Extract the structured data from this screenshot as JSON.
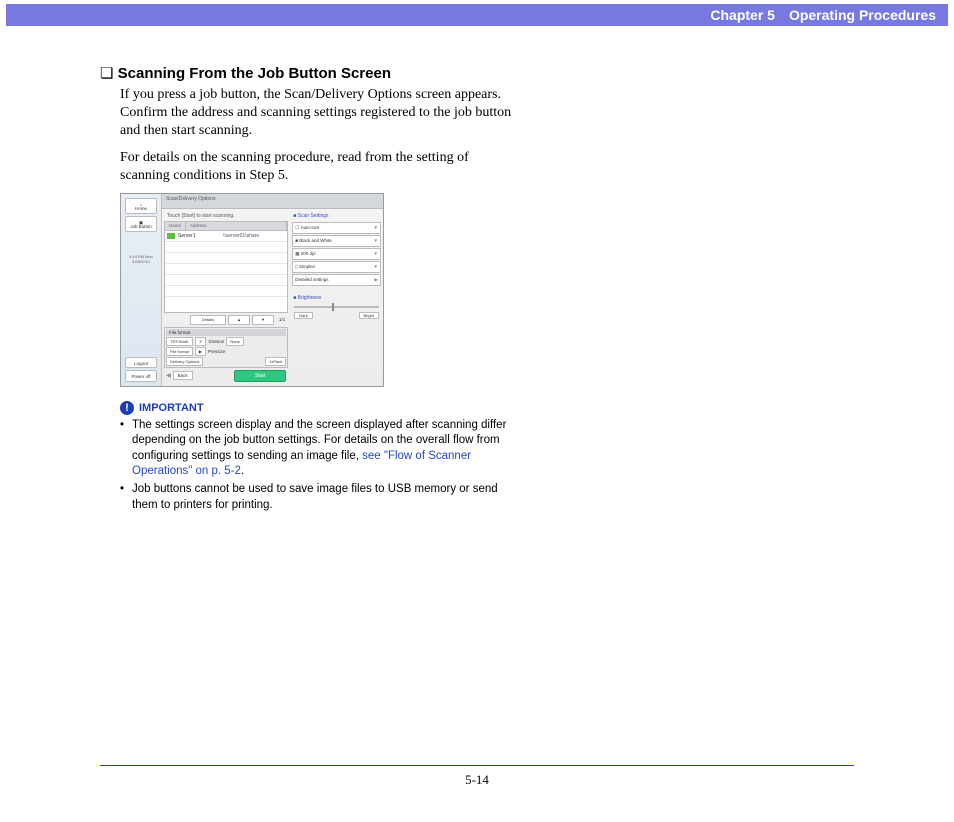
{
  "header": {
    "chapter": "Chapter 5",
    "title": "Operating Procedures"
  },
  "section": {
    "title": "Scanning From the Job Button Screen",
    "para1": "If you press a job button, the Scan/Delivery Options screen appears. Confirm the address and scanning settings registered to the job button and then start scanning.",
    "para2": "For details on the scanning procedure, read from the setting of scanning conditions in Step 5."
  },
  "fig": {
    "titlebar": "Scan/Delivery Options",
    "hint": "Touch [Start] to start scanning.",
    "list_head_name": "Name",
    "list_head_addr": "Address",
    "row_name": "Server1",
    "row_addr": "\\\\server01\\share",
    "pager_detail": "Details",
    "pager_num": "1/1",
    "leftbar": {
      "home": "Home",
      "job": "Job Button",
      "time": "4:44 PM  Mon 3/28/2010",
      "logout": "Logout",
      "poweroff": "Power off"
    },
    "bottom": {
      "bar": "File format",
      "tiff": "TIFF/Multi.",
      "fileformat": "File format",
      "deliv": "Delivery Options",
      "div": "Division",
      "divnone": "None",
      "pre": "Pressize",
      "index": "1xPack"
    },
    "settings": {
      "head": "Scan Settings",
      "auto": "Auto-size",
      "bw": "Black and White",
      "dpi": "200 dpi",
      "simplex": "Simplex",
      "detailed": "Detailed settings",
      "bright_head": "Brightness",
      "dark": "Dark",
      "bright": "Bright"
    },
    "footer": {
      "back": "Back",
      "start": "Start"
    }
  },
  "important": {
    "label": "IMPORTANT",
    "item1_a": "The settings screen display and the screen displayed after scanning differ depending on the job button settings. For details on the overall flow from configuring settings to sending an image file, ",
    "item1_link": "see \"Flow of Scanner Operations\" on p. 5-2",
    "item1_b": ".",
    "item2": "Job buttons cannot be used to save image files to USB memory or send them to printers for printing."
  },
  "page_number": "5-14"
}
